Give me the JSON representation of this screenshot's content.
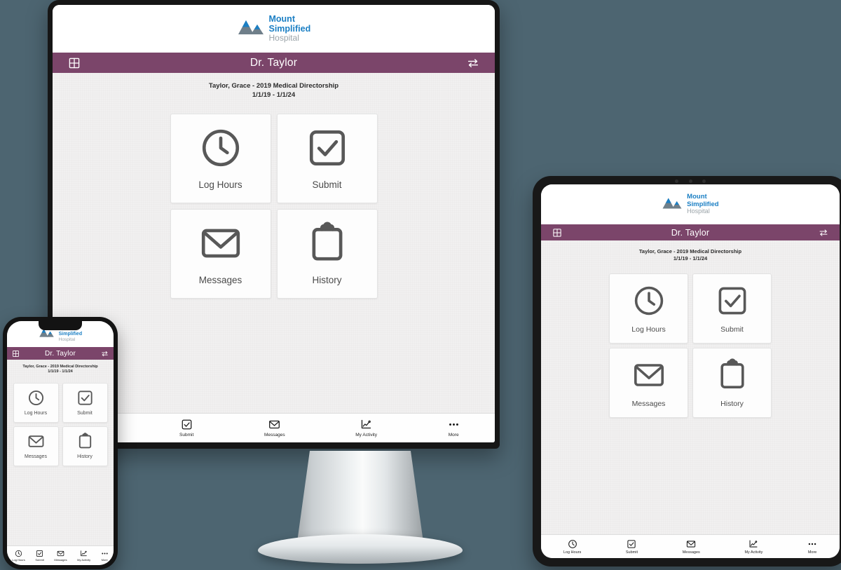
{
  "brand": {
    "logo_line1": "Mount",
    "logo_line2": "Simplified",
    "logo_line3": "Hospital",
    "logo_blue": "#1b7fc4",
    "logo_gray": "#6f7f8a",
    "logo_text_gray": "#9aa3a8",
    "mark_icon": "mountain-logo-icon"
  },
  "colors": {
    "page_background": "#4d6571",
    "header_purple": "#7b456a",
    "content_background": "#f1f0f0",
    "tile_background": "#fdfdfd",
    "icon_gray": "#585858"
  },
  "header": {
    "grid_icon": "grid-icon",
    "title": "Dr. Taylor",
    "swap_icon": "swap-arrows-icon"
  },
  "subtitle": {
    "line1": "Taylor, Grace - 2019 Medical Directorship",
    "line2": "1/1/19 - 1/1/24"
  },
  "tiles": [
    {
      "label": "Log Hours",
      "icon": "clock-icon"
    },
    {
      "label": "Submit",
      "icon": "checkbox-check-icon"
    },
    {
      "label": "Messages",
      "icon": "envelope-icon"
    },
    {
      "label": "History",
      "icon": "clipboard-icon"
    }
  ],
  "tabbar": [
    {
      "label": "Log Hours",
      "icon": "clock-icon"
    },
    {
      "label": "Submit",
      "icon": "checkbox-check-icon"
    },
    {
      "label": "Messages",
      "icon": "envelope-icon"
    },
    {
      "label": "My Activity",
      "icon": "activity-chart-icon"
    },
    {
      "label": "More",
      "icon": "ellipsis-icon"
    }
  ],
  "devices": [
    {
      "name": "desktop-monitor"
    },
    {
      "name": "tablet"
    },
    {
      "name": "phone"
    }
  ]
}
